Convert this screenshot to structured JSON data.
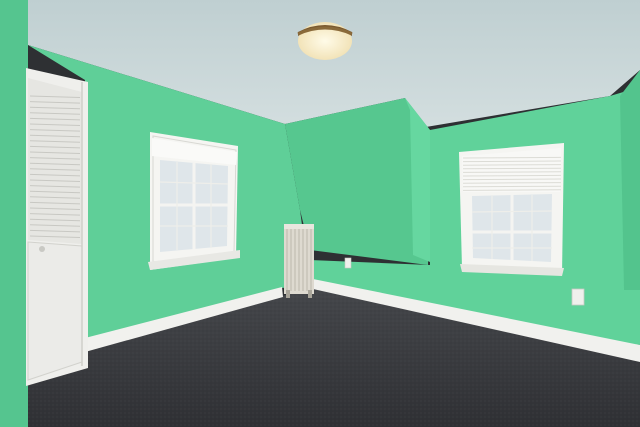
{
  "scene": {
    "kind": "empty attic bedroom",
    "colors": {
      "wall": "#5fcf98",
      "wall_dark": "#4fbc86",
      "wall_light": "#6bd9a4",
      "ceiling": "#c9d6d8",
      "carpet": "#3a3b3f",
      "trim": "#f3f3f0",
      "window_glass": "#dfe6ea"
    },
    "objects": [
      "ceiling-light",
      "louvered-closet-door",
      "left-window",
      "right-window-with-blind",
      "radiator",
      "dormer",
      "baseboard",
      "carpet-floor",
      "wall-outlet"
    ]
  }
}
